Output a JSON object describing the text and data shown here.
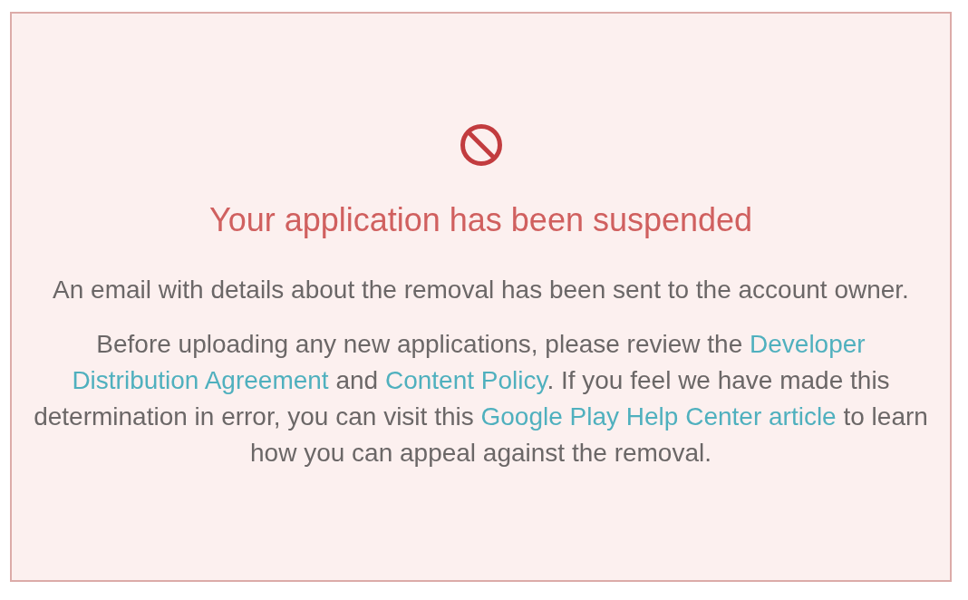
{
  "notice": {
    "title": "Your application has been suspended",
    "paragraphs": [
      {
        "segments": [
          {
            "kind": "text",
            "text": "An email with details about the removal has been sent to the account owner."
          }
        ]
      },
      {
        "segments": [
          {
            "kind": "text",
            "text": "Before uploading any new applications, please review the "
          },
          {
            "kind": "link",
            "text": "Developer"
          },
          {
            "kind": "link",
            "text": "Distribution Agreement"
          },
          {
            "kind": "text",
            "text": " and "
          },
          {
            "kind": "link",
            "text": "Content Policy"
          },
          {
            "kind": "text",
            "text": ". If you feel we have made this determination in error, you can visit this "
          },
          {
            "kind": "link",
            "text": "Google Play Help Center article"
          },
          {
            "kind": "text",
            "text": " to learn how you can appeal against the removal."
          }
        ]
      }
    ]
  }
}
